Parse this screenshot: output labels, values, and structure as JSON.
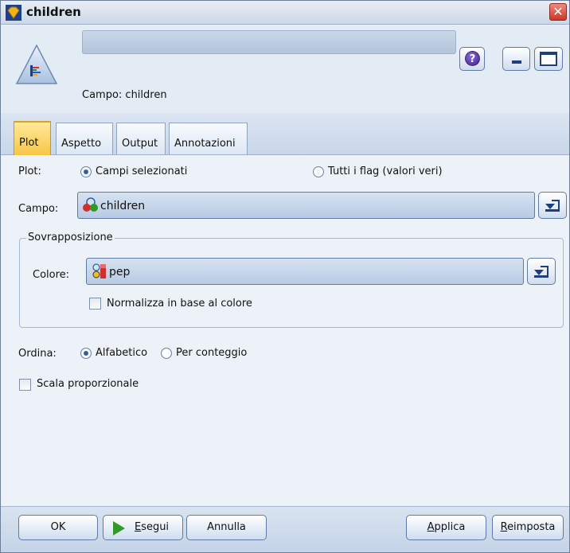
{
  "window": {
    "title": "children",
    "close_label": "✕"
  },
  "header": {
    "name_value": "",
    "field_caption": "Campo: children",
    "help_label": "?"
  },
  "tabs": [
    {
      "label": "Plot",
      "active": true
    },
    {
      "label": "Aspetto",
      "active": false
    },
    {
      "label": "Output",
      "active": false
    },
    {
      "label": "Annotazioni",
      "active": false
    }
  ],
  "plot": {
    "plot_label": "Plot:",
    "option_selected_fields": "Campi selezionati",
    "option_all_flags": "Tutti i flag (valori veri)",
    "selected_option": "Campi selezionati",
    "field_label": "Campo:",
    "field_value": "children",
    "overlay_group_title": "Sovrapposizione",
    "color_label": "Colore:",
    "color_value": "pep",
    "normalize_label": "Normalizza in base al colore",
    "normalize_checked": false,
    "sort_label": "Ordina:",
    "sort_alpha": "Alfabetico",
    "sort_count": "Per conteggio",
    "sort_selected": "Alfabetico",
    "proportional_label": "Scala proporzionale",
    "proportional_checked": false
  },
  "footer": {
    "ok": "OK",
    "run_prefix": "",
    "run_mnemonic": "E",
    "run_rest": "segui",
    "cancel": "Annulla",
    "apply_mnemonic": "A",
    "apply_rest": "pplica",
    "reset_mnemonic": "R",
    "reset_rest": "eimposta"
  },
  "colors": {
    "accent_tab": "#f7c645",
    "field_bg": "#c4d4e8",
    "run_icon": "#2f9a2a",
    "close_btn": "#c8382a"
  }
}
